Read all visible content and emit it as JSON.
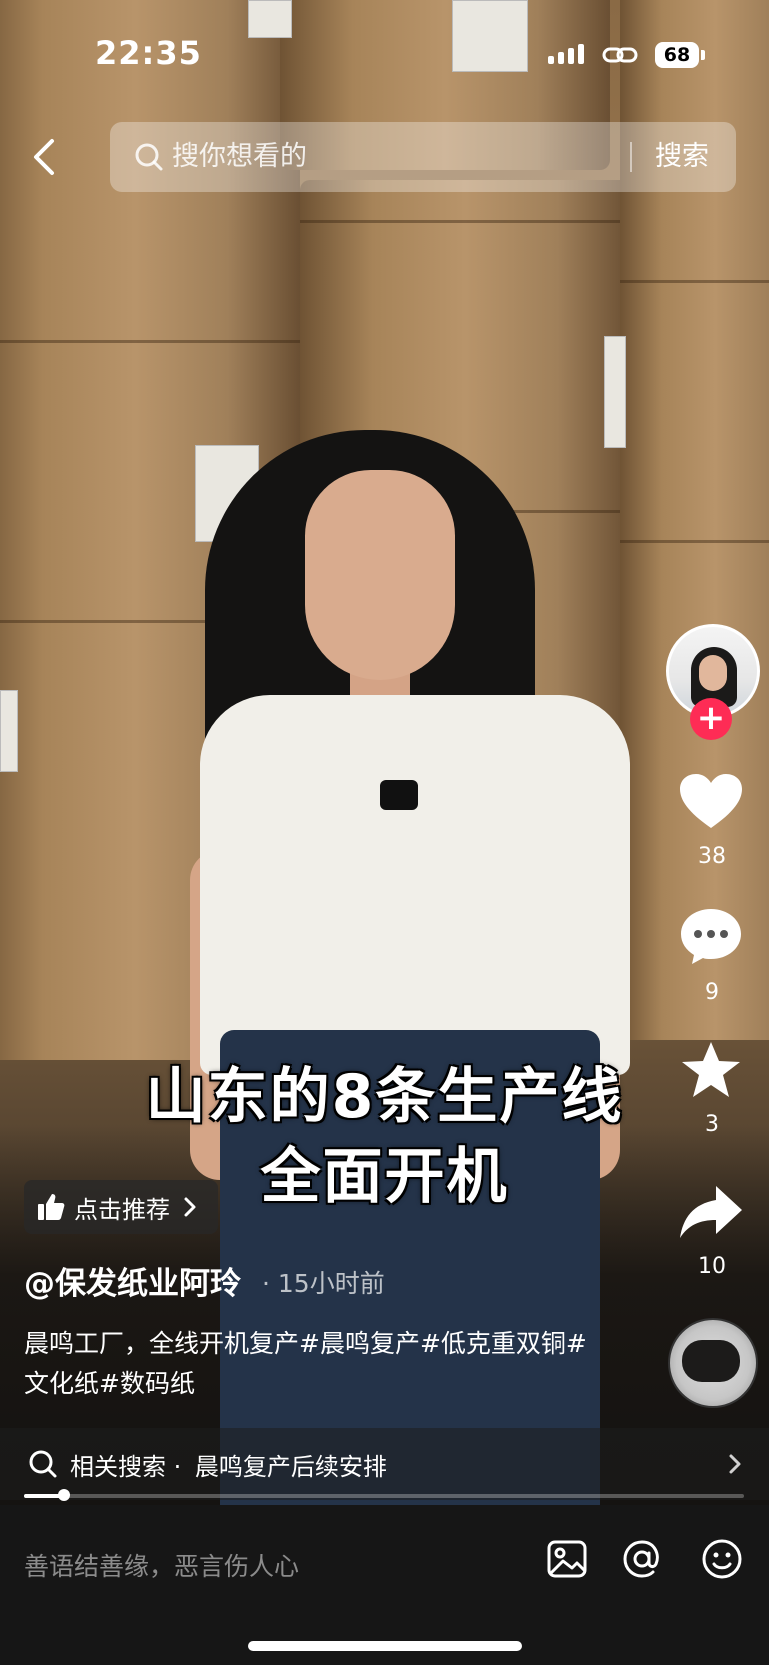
{
  "status_bar": {
    "time": "22:35",
    "battery": "68"
  },
  "search": {
    "placeholder": "搜你想看的",
    "button": "搜索"
  },
  "captions": {
    "line1": "山东的8条生产线",
    "line2": "全面开机"
  },
  "rail": {
    "likes": "38",
    "comments": "9",
    "favorites": "3",
    "shares": "10"
  },
  "recommend": {
    "label": "点击推荐"
  },
  "author": {
    "name": "@保发纸业阿玲",
    "time": "· 15小时前"
  },
  "description": "晨鸣工厂，全线开机复产#晨鸣复产#低克重双铜#文化纸#数码纸",
  "related": {
    "prefix": "相关搜索 ·",
    "query": "晨鸣复产后续安排"
  },
  "progress": {
    "fraction": 0.055
  },
  "comment_bar": {
    "placeholder": "善语结善缘，恶言伤人心"
  },
  "colors": {
    "follow": "#fe2c55",
    "bottom_bar": "#161616"
  }
}
